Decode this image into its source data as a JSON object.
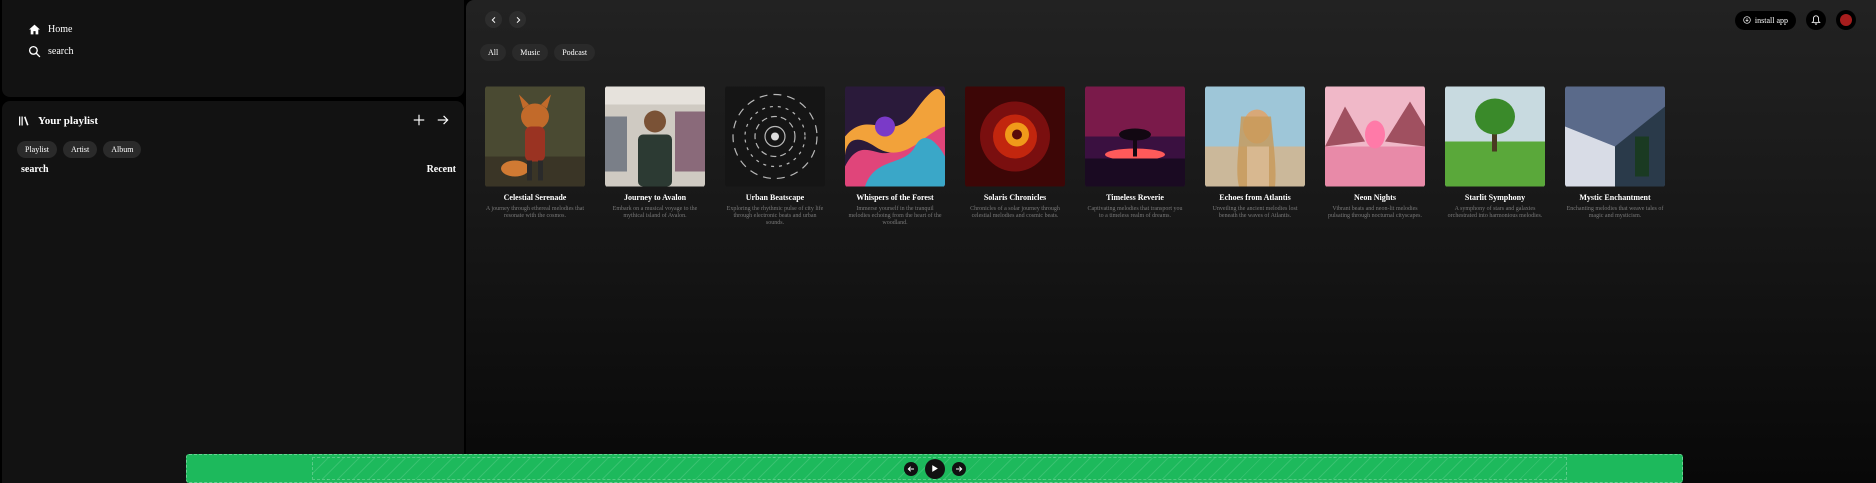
{
  "nav": {
    "home_label": "Home",
    "search_label": "search"
  },
  "library": {
    "title": "Your playlist",
    "chips": [
      "Playlist",
      "Artist",
      "Album"
    ],
    "search_label": "search",
    "recent_label": "Recent"
  },
  "header": {
    "install_label": "install app"
  },
  "filters": [
    "All",
    "Music",
    "Podcast"
  ],
  "cards": [
    {
      "title": "Celestial Serenade",
      "desc": "A journey through ethereal melodies that resonate with the cosmos."
    },
    {
      "title": "Journey to Avalon",
      "desc": "Embark on a musical voyage to the mythical island of Avalon."
    },
    {
      "title": "Urban Beatscape",
      "desc": "Exploring the rhythmic pulse of city life through electronic beats and urban sounds."
    },
    {
      "title": "Whispers of the Forest",
      "desc": "Immerse yourself in the tranquil melodies echoing from the heart of the woodland."
    },
    {
      "title": "Solaris Chronicles",
      "desc": "Chronicles of a solar journey through celestial melodies and cosmic beats."
    },
    {
      "title": "Timeless Reverie",
      "desc": "Captivating melodies that transport you to a timeless realm of dreams."
    },
    {
      "title": "Echoes from Atlantis",
      "desc": "Unveiling the ancient melodies lost beneath the waves of Atlantis."
    },
    {
      "title": "Neon Nights",
      "desc": "Vibrant beats and neon-lit melodies pulsating through nocturnal cityscapes."
    },
    {
      "title": "Starlit Symphony",
      "desc": "A symphony of stars and galaxies orchestrated into harmonious melodies."
    },
    {
      "title": "Mystic Enchantment",
      "desc": "Enchanting melodies that weave tales of magic and mysticism."
    }
  ],
  "colors": {
    "accent": "#1db95c",
    "panel": "#121212",
    "avatar": "#a71d1d"
  }
}
